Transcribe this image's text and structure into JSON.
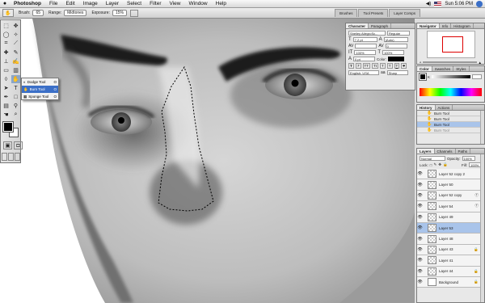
{
  "menubar": {
    "apple": "",
    "app_name": "Photoshop",
    "items": [
      "File",
      "Edit",
      "Image",
      "Layer",
      "Select",
      "Filter",
      "View",
      "Window",
      "Help"
    ],
    "clock": "Sun 5:06 PM"
  },
  "options": {
    "brush_label": "Brush:",
    "brush_value": "65",
    "range_label": "Range:",
    "range_value": "Midtones",
    "exposure_label": "Exposure:",
    "exposure_value": "15%",
    "wells": [
      "Brushes",
      "Tool Presets",
      "Layer Comps"
    ]
  },
  "flyout": {
    "items": [
      {
        "icon": "dodge-tool-icon",
        "label": "Dodge Tool",
        "key": "O"
      },
      {
        "icon": "burn-tool-icon",
        "label": "Burn Tool",
        "key": "O"
      },
      {
        "icon": "sponge-tool-icon",
        "label": "Sponge Tool",
        "key": "O"
      }
    ]
  },
  "character": {
    "tabs": [
      "Character",
      "Paragraph"
    ],
    "font": "Shelley AllegroSc...",
    "style": "Regular",
    "size": "7.2 pt",
    "leading": "(Auto)",
    "tracking": "0",
    "scale_v": "100%",
    "scale_h": "100%",
    "baseline": "0 pt",
    "color_label": "Color:",
    "language": "English: USA",
    "aa": "Sharp",
    "styles": [
      "T",
      "T",
      "TT",
      "Tt",
      "T",
      "T",
      "T",
      "T"
    ]
  },
  "navigator": {
    "tabs": [
      "Navigator",
      "Info",
      "Histogram"
    ],
    "zoom": "50%"
  },
  "color": {
    "tabs": [
      "Color",
      "Swatches",
      "Styles"
    ]
  },
  "history": {
    "tabs": [
      "History",
      "Actions"
    ],
    "items": [
      "Burn Tool",
      "Burn Tool",
      "Burn Tool",
      "Burn Tool"
    ],
    "selected": 2
  },
  "layers": {
    "tabs": [
      "Layers",
      "Channels",
      "Paths"
    ],
    "blend": "Normal",
    "opacity_label": "Opacity:",
    "opacity": "100%",
    "lock_label": "Lock:",
    "fill_label": "Fill:",
    "fill": "100%",
    "rows": [
      "Layer 52 copy 2",
      "Layer 50",
      "Layer 52 copy",
      "Layer 54",
      "Layer 49",
      "Layer 53",
      "Layer 48",
      "Layer 43",
      "Layer 41",
      "Layer 44",
      "Background"
    ]
  },
  "colors": {
    "accent": "#3b6fc7",
    "selected_row": "#a9c4ea",
    "flag": "#b22234"
  }
}
